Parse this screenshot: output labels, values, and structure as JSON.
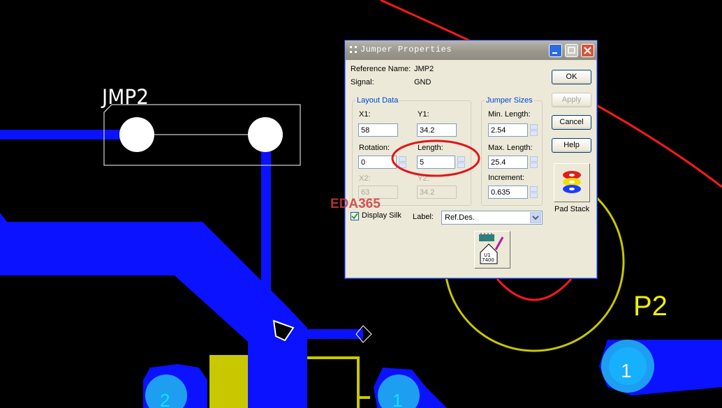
{
  "canvas": {
    "component_label": "JMP2",
    "connector_label": "P2",
    "pin_numbers": [
      "1",
      "2",
      "1"
    ],
    "colors": {
      "background": "#000000",
      "trace": "#0a12ff",
      "pad": "#1e9ef0",
      "silk": "#d3d300",
      "ratsnest": "#ff0000",
      "outline": "#ffffff"
    }
  },
  "dialog": {
    "title": "Jumper Properties",
    "reference_name_label": "Reference Name:",
    "reference_name_value": "JMP2",
    "signal_label": "Signal:",
    "signal_value": "GND",
    "layout_group": {
      "title": "Layout Data",
      "x1_label": "X1:",
      "x1_value": "58",
      "y1_label": "Y1:",
      "y1_value": "34.2",
      "rotation_label": "Rotation:",
      "rotation_value": "0",
      "length_label": "Length:",
      "length_value": "5",
      "x2_label": "X2:",
      "x2_value": "63",
      "y2_label": "Y2:",
      "y2_value": "34.2"
    },
    "sizes_group": {
      "title": "Jumper Sizes",
      "min_label": "Min. Length:",
      "min_value": "2.54",
      "max_label": "Max. Length:",
      "max_value": "25.4",
      "inc_label": "Increment:",
      "inc_value": "0.635"
    },
    "display_silk_label": "Display Silk",
    "display_silk_checked": true,
    "label_label": "Label:",
    "label_value": "Ref.Des.",
    "buttons": {
      "ok": "OK",
      "apply": "Apply",
      "cancel": "Cancel",
      "help": "Help"
    },
    "pad_stack_label": "Pad Stack",
    "chip_icon_text": [
      "U1",
      "7400"
    ]
  },
  "watermark": "EDA365",
  "highlight_color": "#e0161b"
}
